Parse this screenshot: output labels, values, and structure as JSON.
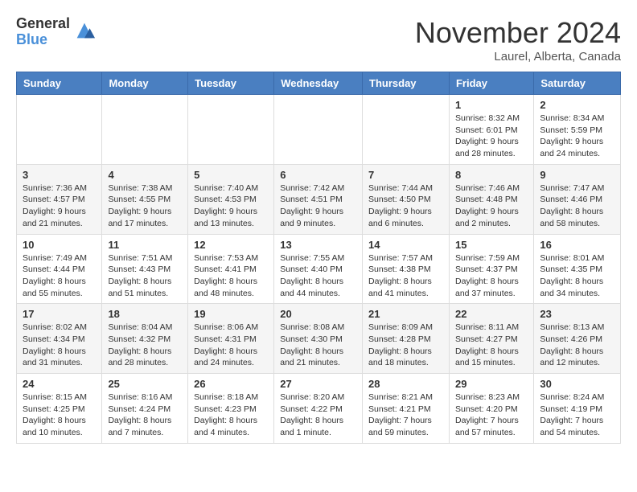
{
  "logo": {
    "general": "General",
    "blue": "Blue"
  },
  "title": {
    "month": "November 2024",
    "location": "Laurel, Alberta, Canada"
  },
  "weekdays": [
    "Sunday",
    "Monday",
    "Tuesday",
    "Wednesday",
    "Thursday",
    "Friday",
    "Saturday"
  ],
  "weeks": [
    [
      {
        "day": "",
        "info": ""
      },
      {
        "day": "",
        "info": ""
      },
      {
        "day": "",
        "info": ""
      },
      {
        "day": "",
        "info": ""
      },
      {
        "day": "",
        "info": ""
      },
      {
        "day": "1",
        "info": "Sunrise: 8:32 AM\nSunset: 6:01 PM\nDaylight: 9 hours and 28 minutes."
      },
      {
        "day": "2",
        "info": "Sunrise: 8:34 AM\nSunset: 5:59 PM\nDaylight: 9 hours and 24 minutes."
      }
    ],
    [
      {
        "day": "3",
        "info": "Sunrise: 7:36 AM\nSunset: 4:57 PM\nDaylight: 9 hours and 21 minutes."
      },
      {
        "day": "4",
        "info": "Sunrise: 7:38 AM\nSunset: 4:55 PM\nDaylight: 9 hours and 17 minutes."
      },
      {
        "day": "5",
        "info": "Sunrise: 7:40 AM\nSunset: 4:53 PM\nDaylight: 9 hours and 13 minutes."
      },
      {
        "day": "6",
        "info": "Sunrise: 7:42 AM\nSunset: 4:51 PM\nDaylight: 9 hours and 9 minutes."
      },
      {
        "day": "7",
        "info": "Sunrise: 7:44 AM\nSunset: 4:50 PM\nDaylight: 9 hours and 6 minutes."
      },
      {
        "day": "8",
        "info": "Sunrise: 7:46 AM\nSunset: 4:48 PM\nDaylight: 9 hours and 2 minutes."
      },
      {
        "day": "9",
        "info": "Sunrise: 7:47 AM\nSunset: 4:46 PM\nDaylight: 8 hours and 58 minutes."
      }
    ],
    [
      {
        "day": "10",
        "info": "Sunrise: 7:49 AM\nSunset: 4:44 PM\nDaylight: 8 hours and 55 minutes."
      },
      {
        "day": "11",
        "info": "Sunrise: 7:51 AM\nSunset: 4:43 PM\nDaylight: 8 hours and 51 minutes."
      },
      {
        "day": "12",
        "info": "Sunrise: 7:53 AM\nSunset: 4:41 PM\nDaylight: 8 hours and 48 minutes."
      },
      {
        "day": "13",
        "info": "Sunrise: 7:55 AM\nSunset: 4:40 PM\nDaylight: 8 hours and 44 minutes."
      },
      {
        "day": "14",
        "info": "Sunrise: 7:57 AM\nSunset: 4:38 PM\nDaylight: 8 hours and 41 minutes."
      },
      {
        "day": "15",
        "info": "Sunrise: 7:59 AM\nSunset: 4:37 PM\nDaylight: 8 hours and 37 minutes."
      },
      {
        "day": "16",
        "info": "Sunrise: 8:01 AM\nSunset: 4:35 PM\nDaylight: 8 hours and 34 minutes."
      }
    ],
    [
      {
        "day": "17",
        "info": "Sunrise: 8:02 AM\nSunset: 4:34 PM\nDaylight: 8 hours and 31 minutes."
      },
      {
        "day": "18",
        "info": "Sunrise: 8:04 AM\nSunset: 4:32 PM\nDaylight: 8 hours and 28 minutes."
      },
      {
        "day": "19",
        "info": "Sunrise: 8:06 AM\nSunset: 4:31 PM\nDaylight: 8 hours and 24 minutes."
      },
      {
        "day": "20",
        "info": "Sunrise: 8:08 AM\nSunset: 4:30 PM\nDaylight: 8 hours and 21 minutes."
      },
      {
        "day": "21",
        "info": "Sunrise: 8:09 AM\nSunset: 4:28 PM\nDaylight: 8 hours and 18 minutes."
      },
      {
        "day": "22",
        "info": "Sunrise: 8:11 AM\nSunset: 4:27 PM\nDaylight: 8 hours and 15 minutes."
      },
      {
        "day": "23",
        "info": "Sunrise: 8:13 AM\nSunset: 4:26 PM\nDaylight: 8 hours and 12 minutes."
      }
    ],
    [
      {
        "day": "24",
        "info": "Sunrise: 8:15 AM\nSunset: 4:25 PM\nDaylight: 8 hours and 10 minutes."
      },
      {
        "day": "25",
        "info": "Sunrise: 8:16 AM\nSunset: 4:24 PM\nDaylight: 8 hours and 7 minutes."
      },
      {
        "day": "26",
        "info": "Sunrise: 8:18 AM\nSunset: 4:23 PM\nDaylight: 8 hours and 4 minutes."
      },
      {
        "day": "27",
        "info": "Sunrise: 8:20 AM\nSunset: 4:22 PM\nDaylight: 8 hours and 1 minute."
      },
      {
        "day": "28",
        "info": "Sunrise: 8:21 AM\nSunset: 4:21 PM\nDaylight: 7 hours and 59 minutes."
      },
      {
        "day": "29",
        "info": "Sunrise: 8:23 AM\nSunset: 4:20 PM\nDaylight: 7 hours and 57 minutes."
      },
      {
        "day": "30",
        "info": "Sunrise: 8:24 AM\nSunset: 4:19 PM\nDaylight: 7 hours and 54 minutes."
      }
    ]
  ]
}
